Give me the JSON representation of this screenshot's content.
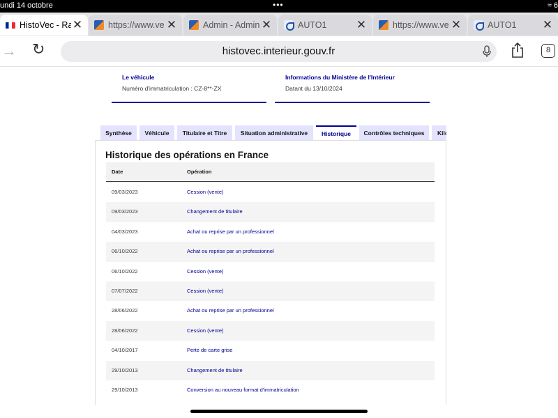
{
  "status": {
    "time": "undi 14 octobre",
    "dots": "•••",
    "right": "≈ 6"
  },
  "browser_tabs": [
    {
      "label": "HistoVec - Rapp",
      "favicon": "flag-fr-icon",
      "active": true
    },
    {
      "label": "https://www.ve",
      "favicon": "site-icon",
      "active": false
    },
    {
      "label": "Admin - Admin",
      "favicon": "site-icon",
      "active": false
    },
    {
      "label": "AUTO1",
      "favicon": "auto1-icon",
      "active": false
    },
    {
      "label": "https://www.ve",
      "favicon": "site-icon",
      "active": false
    },
    {
      "label": "AUTO1",
      "favicon": "auto1-icon",
      "active": false
    }
  ],
  "toolbar": {
    "url": "histovec.interieur.gouv.fr",
    "tab_count": "8"
  },
  "cards": [
    {
      "title": "Le véhicule",
      "text": "Numéro d'immatriculation : CZ-8**-ZX"
    },
    {
      "title": "Informations du Ministère de l'Intérieur",
      "text": "Datant du 13/10/2024"
    }
  ],
  "page_tabs": [
    {
      "label": "Synthèse",
      "active": false
    },
    {
      "label": "Véhicule",
      "active": false
    },
    {
      "label": "Titulaire et Titre",
      "active": false
    },
    {
      "label": "Situation administrative",
      "active": false
    },
    {
      "label": "Historique",
      "active": true
    },
    {
      "label": "Contrôles techniques",
      "active": false
    },
    {
      "label": "Kilo",
      "active": false
    }
  ],
  "history": {
    "title": "Historique des opérations en France",
    "columns": [
      "Date",
      "Opération"
    ],
    "rows": [
      {
        "date": "09/03/2023",
        "operation": "Cession (vente)"
      },
      {
        "date": "09/03/2023",
        "operation": "Changement de titulaire"
      },
      {
        "date": "04/03/2023",
        "operation": "Achat ou reprise par un professionnel"
      },
      {
        "date": "06/10/2022",
        "operation": "Achat ou reprise par un professionnel"
      },
      {
        "date": "06/10/2022",
        "operation": "Cession (vente)"
      },
      {
        "date": "07/07/2022",
        "operation": "Cession (vente)"
      },
      {
        "date": "28/06/2022",
        "operation": "Achat ou reprise par un professionnel"
      },
      {
        "date": "28/06/2022",
        "operation": "Cession (vente)"
      },
      {
        "date": "04/10/2017",
        "operation": "Perte de carte grise"
      },
      {
        "date": "29/10/2013",
        "operation": "Changement de titulaire"
      },
      {
        "date": "29/10/2013",
        "operation": "Conversion au nouveau format d'immatriculation"
      }
    ]
  },
  "colors": {
    "accent": "#000091",
    "tab_bg": "#e3e3fd"
  }
}
